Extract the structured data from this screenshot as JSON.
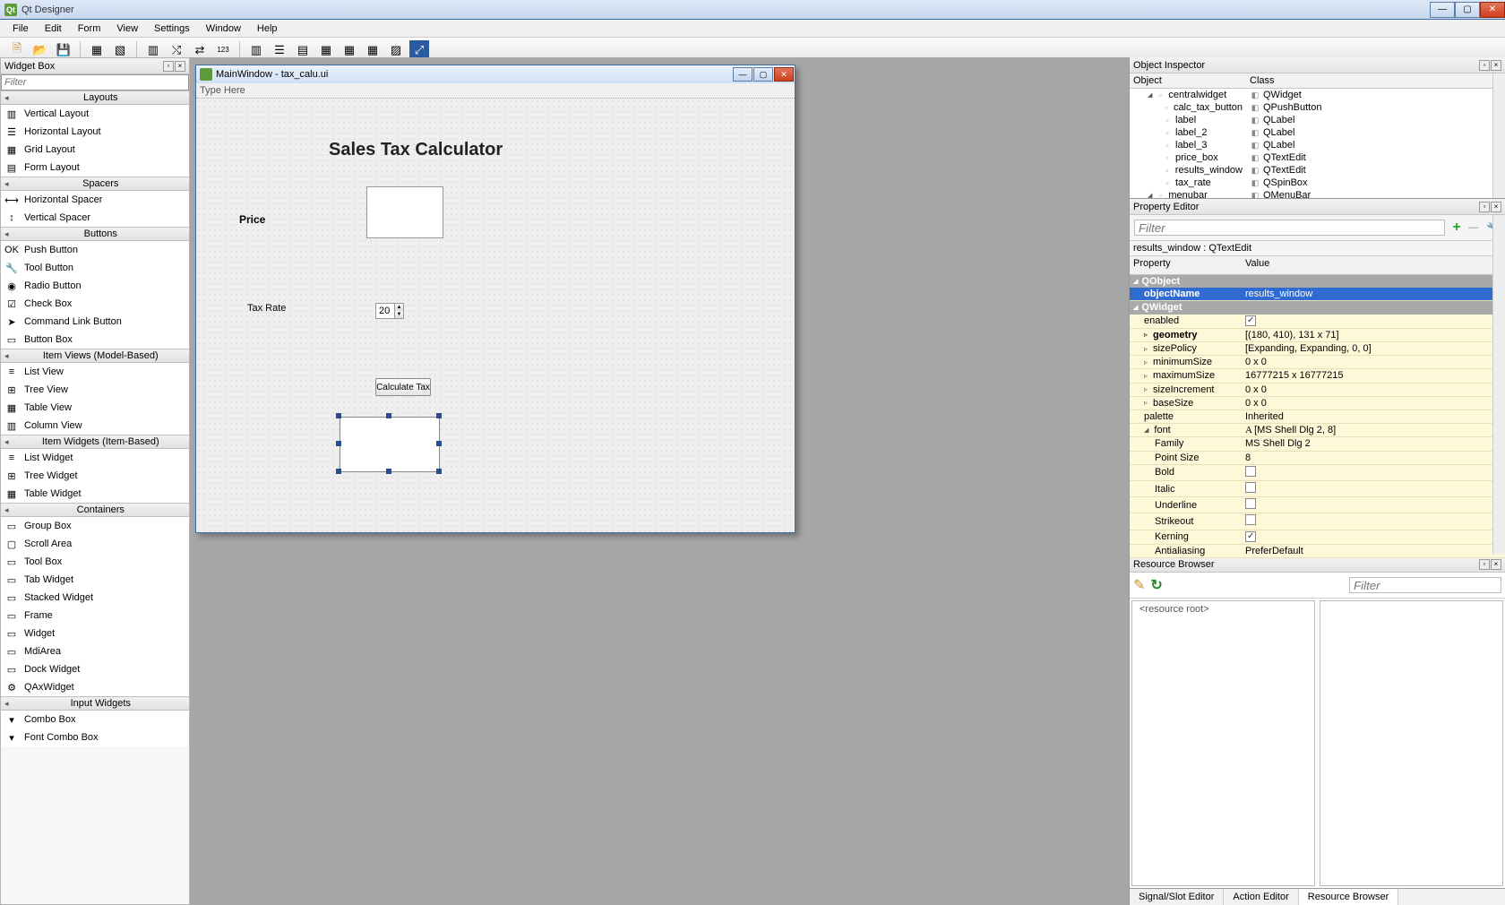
{
  "app": {
    "title": "Qt Designer"
  },
  "menu": [
    "File",
    "Edit",
    "Form",
    "View",
    "Settings",
    "Window",
    "Help"
  ],
  "widgetbox": {
    "title": "Widget Box",
    "filter_placeholder": "Filter",
    "sections": {
      "layouts": {
        "label": "Layouts",
        "items": [
          "Vertical Layout",
          "Horizontal Layout",
          "Grid Layout",
          "Form Layout"
        ]
      },
      "spacers": {
        "label": "Spacers",
        "items": [
          "Horizontal Spacer",
          "Vertical Spacer"
        ]
      },
      "buttons": {
        "label": "Buttons",
        "items": [
          "Push Button",
          "Tool Button",
          "Radio Button",
          "Check Box",
          "Command Link Button",
          "Button Box"
        ]
      },
      "item_views": {
        "label": "Item Views (Model-Based)",
        "items": [
          "List View",
          "Tree View",
          "Table View",
          "Column View"
        ]
      },
      "item_widgets": {
        "label": "Item Widgets (Item-Based)",
        "items": [
          "List Widget",
          "Tree Widget",
          "Table Widget"
        ]
      },
      "containers": {
        "label": "Containers",
        "items": [
          "Group Box",
          "Scroll Area",
          "Tool Box",
          "Tab Widget",
          "Stacked Widget",
          "Frame",
          "Widget",
          "MdiArea",
          "Dock Widget",
          "QAxWidget"
        ]
      },
      "input_widgets": {
        "label": "Input Widgets",
        "items": [
          "Combo Box",
          "Font Combo Box"
        ]
      }
    }
  },
  "formwin": {
    "title": "MainWindow - tax_calu.ui",
    "type_here": "Type Here",
    "heading": "Sales Tax Calculator",
    "price_label": "Price",
    "rate_label": "Tax Rate",
    "rate_value": "20",
    "calc_label": "Calculate Tax"
  },
  "objinsp": {
    "title": "Object Inspector",
    "col_obj": "Object",
    "col_cls": "Class",
    "rows": [
      {
        "obj": "centralwidget",
        "cls": "QWidget",
        "indent": 1
      },
      {
        "obj": "calc_tax_button",
        "cls": "QPushButton",
        "indent": 2
      },
      {
        "obj": "label",
        "cls": "QLabel",
        "indent": 2
      },
      {
        "obj": "label_2",
        "cls": "QLabel",
        "indent": 2
      },
      {
        "obj": "label_3",
        "cls": "QLabel",
        "indent": 2
      },
      {
        "obj": "price_box",
        "cls": "QTextEdit",
        "indent": 2
      },
      {
        "obj": "results_window",
        "cls": "QTextEdit",
        "indent": 2
      },
      {
        "obj": "tax_rate",
        "cls": "QSpinBox",
        "indent": 2
      },
      {
        "obj": "menubar",
        "cls": "QMenuBar",
        "indent": 1
      }
    ]
  },
  "propedit": {
    "title": "Property Editor",
    "filter_placeholder": "Filter",
    "obj_label": "results_window : QTextEdit",
    "col_prop": "Property",
    "col_val": "Value",
    "rows": [
      {
        "kind": "cat",
        "name": "QObject"
      },
      {
        "kind": "prop",
        "name": "objectName",
        "value": "results_window",
        "selected": true,
        "bold": true
      },
      {
        "kind": "cat",
        "name": "QWidget"
      },
      {
        "kind": "prop",
        "name": "enabled",
        "value_chk": true
      },
      {
        "kind": "prop",
        "name": "geometry",
        "value": "[(180, 410), 131 x 71]",
        "bold": true,
        "expand": true
      },
      {
        "kind": "prop",
        "name": "sizePolicy",
        "value": "[Expanding, Expanding, 0, 0]",
        "expand": true
      },
      {
        "kind": "prop",
        "name": "minimumSize",
        "value": "0 x 0",
        "expand": true
      },
      {
        "kind": "prop",
        "name": "maximumSize",
        "value": "16777215 x 16777215",
        "expand": true
      },
      {
        "kind": "prop",
        "name": "sizeIncrement",
        "value": "0 x 0",
        "expand": true
      },
      {
        "kind": "prop",
        "name": "baseSize",
        "value": "0 x 0",
        "expand": true
      },
      {
        "kind": "prop",
        "name": "palette",
        "value": "Inherited"
      },
      {
        "kind": "prop",
        "name": "font",
        "value": "[MS Shell Dlg 2, 8]",
        "expand_open": true,
        "font_icon": true
      },
      {
        "kind": "sub",
        "name": "Family",
        "value": "MS Shell Dlg 2"
      },
      {
        "kind": "sub",
        "name": "Point Size",
        "value": "8"
      },
      {
        "kind": "sub",
        "name": "Bold",
        "value_chk": false
      },
      {
        "kind": "sub",
        "name": "Italic",
        "value_chk": false
      },
      {
        "kind": "sub",
        "name": "Underline",
        "value_chk": false
      },
      {
        "kind": "sub",
        "name": "Strikeout",
        "value_chk": false
      },
      {
        "kind": "sub",
        "name": "Kerning",
        "value_chk": true
      },
      {
        "kind": "sub",
        "name": "Antialiasing",
        "value": "PreferDefault"
      }
    ]
  },
  "resbrowser": {
    "title": "Resource Browser",
    "filter_placeholder": "Filter",
    "root_label": "<resource root>"
  },
  "tabs": {
    "signal": "Signal/Slot Editor",
    "action": "Action Editor",
    "resource": "Resource Browser"
  }
}
